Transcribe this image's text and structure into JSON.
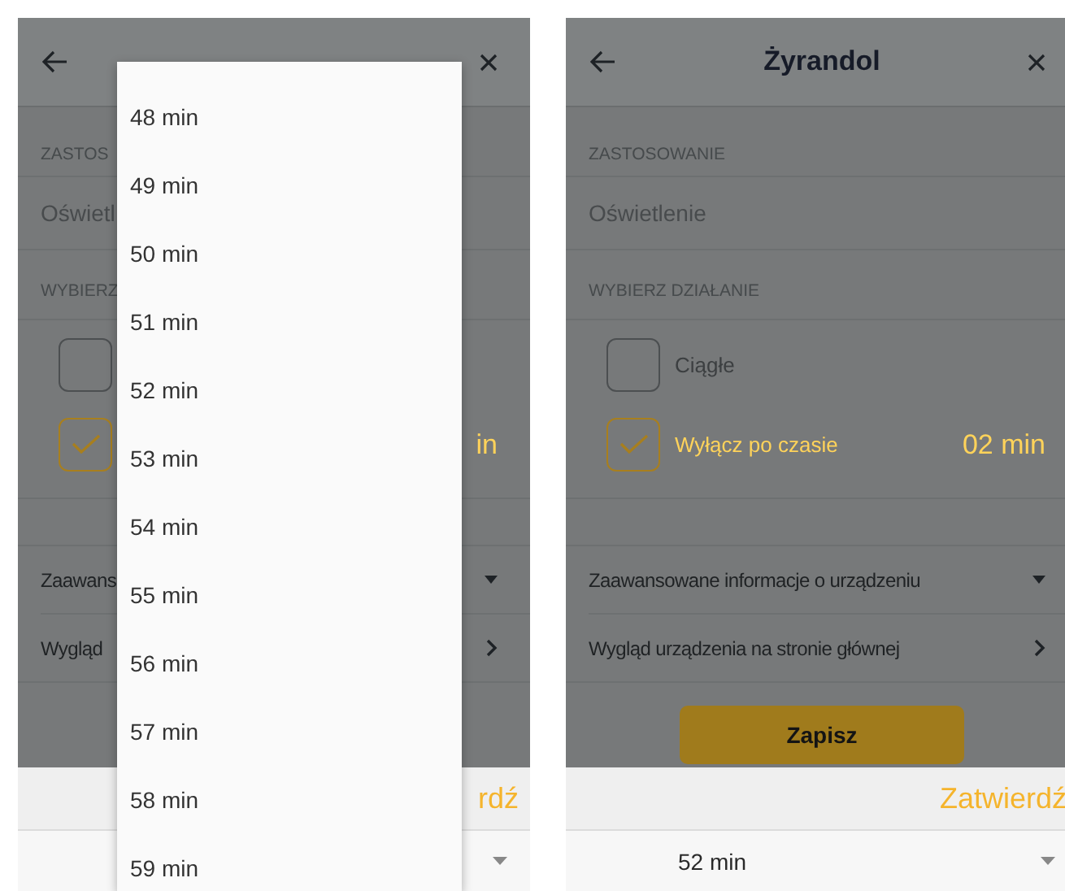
{
  "screens": [
    {
      "application_label": "ZASTOS",
      "application_value": "Oświetl",
      "action_label": "WYBIERZ",
      "options": [
        {
          "checked": false
        },
        {
          "checked": true,
          "value": "in"
        }
      ],
      "links": [
        {
          "label": "Zaawans",
          "kind": "dropdown"
        },
        {
          "label": "Wygląd",
          "kind": "chevron"
        }
      ],
      "sheet": {
        "confirm": "rdź"
      },
      "dropdown": {
        "items": [
          "48 min",
          "49 min",
          "50 min",
          "51 min",
          "52 min",
          "53 min",
          "54 min",
          "55 min",
          "56 min",
          "57 min",
          "58 min",
          "59 min"
        ]
      }
    },
    {
      "header": {
        "title": "Żyrandol"
      },
      "application_label": "ZASTOSOWANIE",
      "application_value": "Oświetlenie",
      "action_label": "WYBIERZ DZIAŁANIE",
      "options": [
        {
          "label": "Ciągłe",
          "checked": false
        },
        {
          "label": "Wyłącz po czasie",
          "checked": true,
          "value": "02 min"
        }
      ],
      "links": [
        {
          "label": "Zaawansowane informacje o urządzeniu",
          "kind": "dropdown"
        },
        {
          "label": "Wygląd urządzenia na stronie głównej",
          "kind": "chevron"
        }
      ],
      "save_button": "Zapisz",
      "sheet": {
        "confirm": "Zatwierdź",
        "select_value": "52 min"
      }
    }
  ]
}
